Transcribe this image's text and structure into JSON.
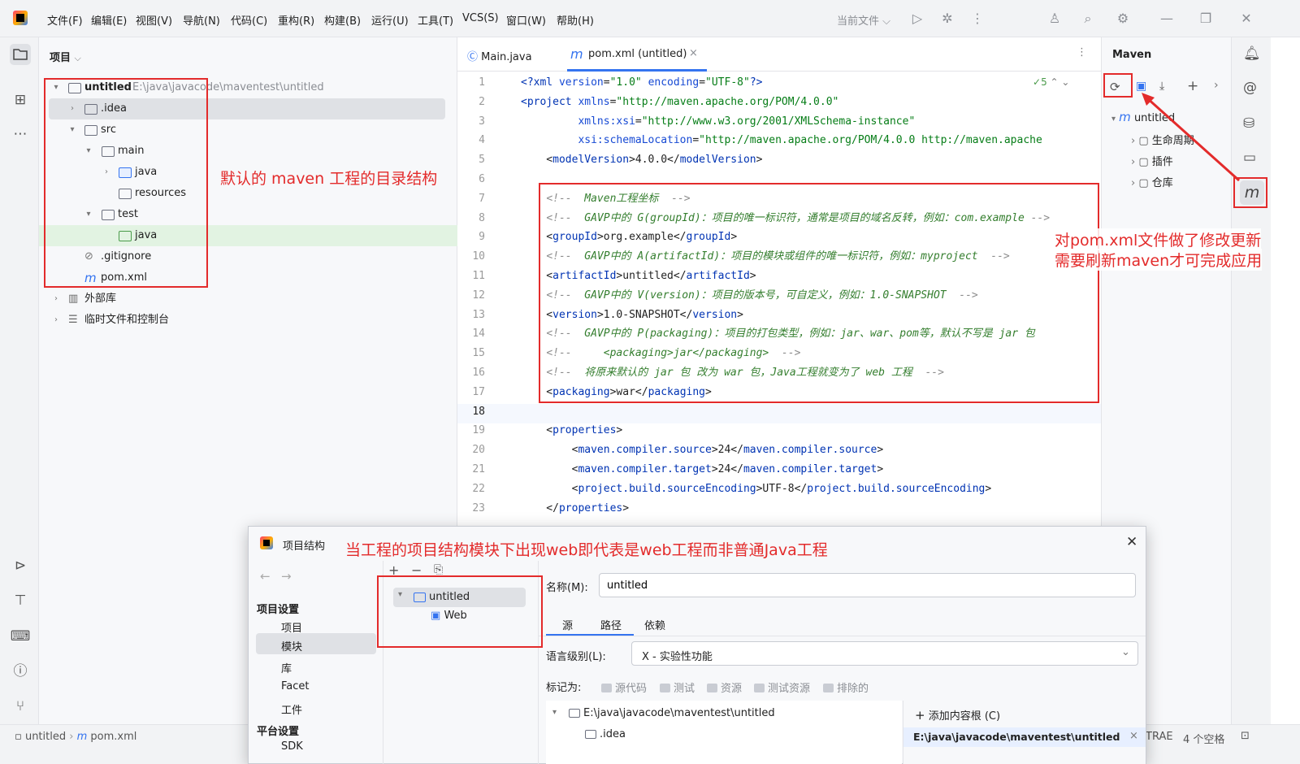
{
  "menu": [
    "文件(F)",
    "编辑(E)",
    "视图(V)",
    "导航(N)",
    "代码(C)",
    "重构(R)",
    "构建(B)",
    "运行(U)",
    "工具(T)",
    "VCS(S)",
    "窗口(W)",
    "帮助(H)"
  ],
  "run_config": "当前文件",
  "project_panel": {
    "title": "项目",
    "tree": [
      {
        "label": "untitled",
        "path": "E:\\java\\javacode\\maventest\\untitled"
      },
      {
        "label": ".idea"
      },
      {
        "label": "src"
      },
      {
        "label": "main"
      },
      {
        "label": "java"
      },
      {
        "label": "resources"
      },
      {
        "label": "test"
      },
      {
        "label": "java"
      },
      {
        "label": ".gitignore"
      },
      {
        "label": "pom.xml"
      },
      {
        "label": "外部库"
      },
      {
        "label": "临时文件和控制台"
      }
    ]
  },
  "editor": {
    "tabs": [
      {
        "label": "Main.java"
      },
      {
        "label": "pom.xml (untitled)"
      }
    ],
    "inspection_count": "5",
    "lines": [
      {
        "n": "1"
      },
      {
        "n": "2"
      },
      {
        "n": "3"
      },
      {
        "n": "4"
      },
      {
        "n": "5"
      },
      {
        "n": "6"
      },
      {
        "n": "7"
      },
      {
        "n": "8"
      },
      {
        "n": "9"
      },
      {
        "n": "10"
      },
      {
        "n": "11"
      },
      {
        "n": "12"
      },
      {
        "n": "13"
      },
      {
        "n": "14"
      },
      {
        "n": "15"
      },
      {
        "n": "16"
      },
      {
        "n": "17"
      },
      {
        "n": "18"
      },
      {
        "n": "19"
      },
      {
        "n": "20"
      },
      {
        "n": "21"
      },
      {
        "n": "22"
      },
      {
        "n": "23"
      }
    ]
  },
  "maven": {
    "title": "Maven",
    "tree": [
      {
        "label": "untitled"
      },
      {
        "label": "生命周期"
      },
      {
        "label": "插件"
      },
      {
        "label": "仓库"
      }
    ]
  },
  "annotations": {
    "dir_structure": "默认的 maven 工程的目录结构",
    "pom_refresh_line1": "对pom.xml文件做了修改更新",
    "pom_refresh_line2": "需要刷新maven才可完成应用",
    "web_project": "当工程的项目结构模块下出现web即代表是web工程而非普通Java工程"
  },
  "status": {
    "breadcrumb_project": "untitled",
    "breadcrumb_file": "pom.xml",
    "right1": "TRAE",
    "right2": "4 个空格"
  },
  "dialog": {
    "title": "项目结构",
    "left_nav": {
      "section1": "项目设置",
      "items1": [
        "项目",
        "模块",
        "库",
        "Facet",
        "工件"
      ],
      "section2": "平台设置",
      "items2": [
        "SDK"
      ]
    },
    "module_tree": [
      "untitled",
      "Web"
    ],
    "name_label": "名称(M):",
    "name_value": "untitled",
    "tabs": [
      "源",
      "路径",
      "依赖"
    ],
    "lang_label": "语言级别(L):",
    "lang_value": "X - 实验性功能",
    "mark_as": "标记为:",
    "mark_chips": [
      "源代码",
      "测试",
      "资源",
      "测试资源",
      "排除的"
    ],
    "content_root": "E:\\java\\javacode\\maventest\\untitled",
    "content_child": ".idea",
    "add_root": "添加内容根 (C)",
    "root_path": "E:\\java\\javacode\\maventest\\untitled"
  }
}
